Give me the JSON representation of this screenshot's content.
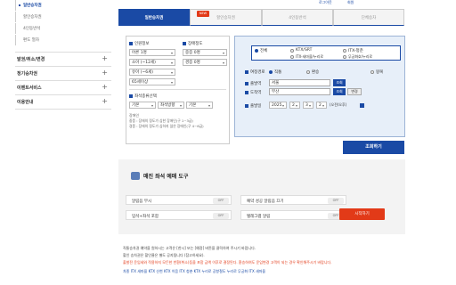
{
  "sidebar": {
    "sub_items": [
      {
        "label": "일반승차권",
        "active": true
      },
      {
        "label": "할인승차권",
        "active": false
      },
      {
        "label": "4인동반석",
        "active": false
      },
      {
        "label": "편도 열차",
        "active": false
      }
    ],
    "main_items": [
      {
        "label": "발권/취소/변경",
        "icon": "+"
      },
      {
        "label": "정기승차권",
        "icon": "+"
      },
      {
        "label": "이벤트서비스",
        "icon": "+"
      },
      {
        "label": "이용안내",
        "icon": "+"
      }
    ]
  },
  "topright": {
    "a": "로그아웃",
    "b": "회원"
  },
  "tabs": [
    {
      "label": "일반승차권",
      "active": true
    },
    {
      "label": "할인승차권",
      "active": false
    },
    {
      "label": "4인동반석",
      "active": false
    },
    {
      "label": "단체승차",
      "active": false
    }
  ],
  "new_badge": "NEW",
  "passengers": {
    "adult_label": "인원정보",
    "adult_value": "어른 1명",
    "senior_value": "노인(65세 이상) 0명",
    "child1_value": "유아 0명",
    "child2_value": "어린이(만 6~12세) 0명",
    "sub_items": [
      "어른 1명",
      "소아 (~12세)",
      "유아 (~6세)",
      "65세이상"
    ],
    "disability_label": "장애정도",
    "disability_values": [
      "중증 0명",
      "경증 0명"
    ],
    "seat_label": "좌석종류선택",
    "seat_values": [
      "기본",
      "좌석방향",
      "기본"
    ],
    "notes": [
      "장애인",
      "중증 : 장애의 정도가 심한 장애인(구 1~3급)",
      "경증 : 장애의 정도가 심하지 않은 장애인(구 4~6급)"
    ]
  },
  "train_type": {
    "options": [
      "전체",
      "KTX/SRT",
      "ITX-청춘",
      "ITX-새마을/누리로",
      "무궁화호/누리로"
    ],
    "selected": "전체"
  },
  "trip": {
    "label": "여정경로",
    "options": [
      "직통",
      "환승",
      "왕복"
    ],
    "selected": "직통"
  },
  "departure": {
    "label": "출발역",
    "value": "서울",
    "button": "조회"
  },
  "arrival": {
    "label": "도착역",
    "value": "부산",
    "button": "조회",
    "swap": "변경"
  },
  "date": {
    "label": "출발일",
    "year": "2025",
    "month": "2",
    "day": "3",
    "hour": "2",
    "suffix": "(오전/오후)"
  },
  "search_button": "조회하기",
  "tool": {
    "title": "매진 좌석 예매 도구",
    "rows": [
      {
        "label": "알림음 무시",
        "state": "OFF"
      },
      {
        "label": "예약 성공 알림음 끄기",
        "state": "OFF"
      },
      {
        "label": "입석+좌석 포함",
        "state": "OFF"
      },
      {
        "label": "텔레그램 알림",
        "state": "OFF"
      }
    ],
    "start": "시작하기"
  },
  "notes": [
    "직통승차권 예약을 원하시는 고객은 [한시] 또는 [예정] 버튼을 클릭하여 주시기 바랍니다.",
    "할인 승차권은 할인율은 별도 공지됩니다 (참고하세요).",
    "출발전 운임세와 적용하지 모든한 반환(취소)등을 포함 금액 이후로 결정된다. 환승하여도 운임변경 고객이 되는 경우 확인해주시기 바랍니다.",
    "차종 ITX 새마을 KTX 산천 KTX 이음 ITX 청춘 KTX 누리로 공항철도 누리로 무궁화 ITX 새마을"
  ]
}
